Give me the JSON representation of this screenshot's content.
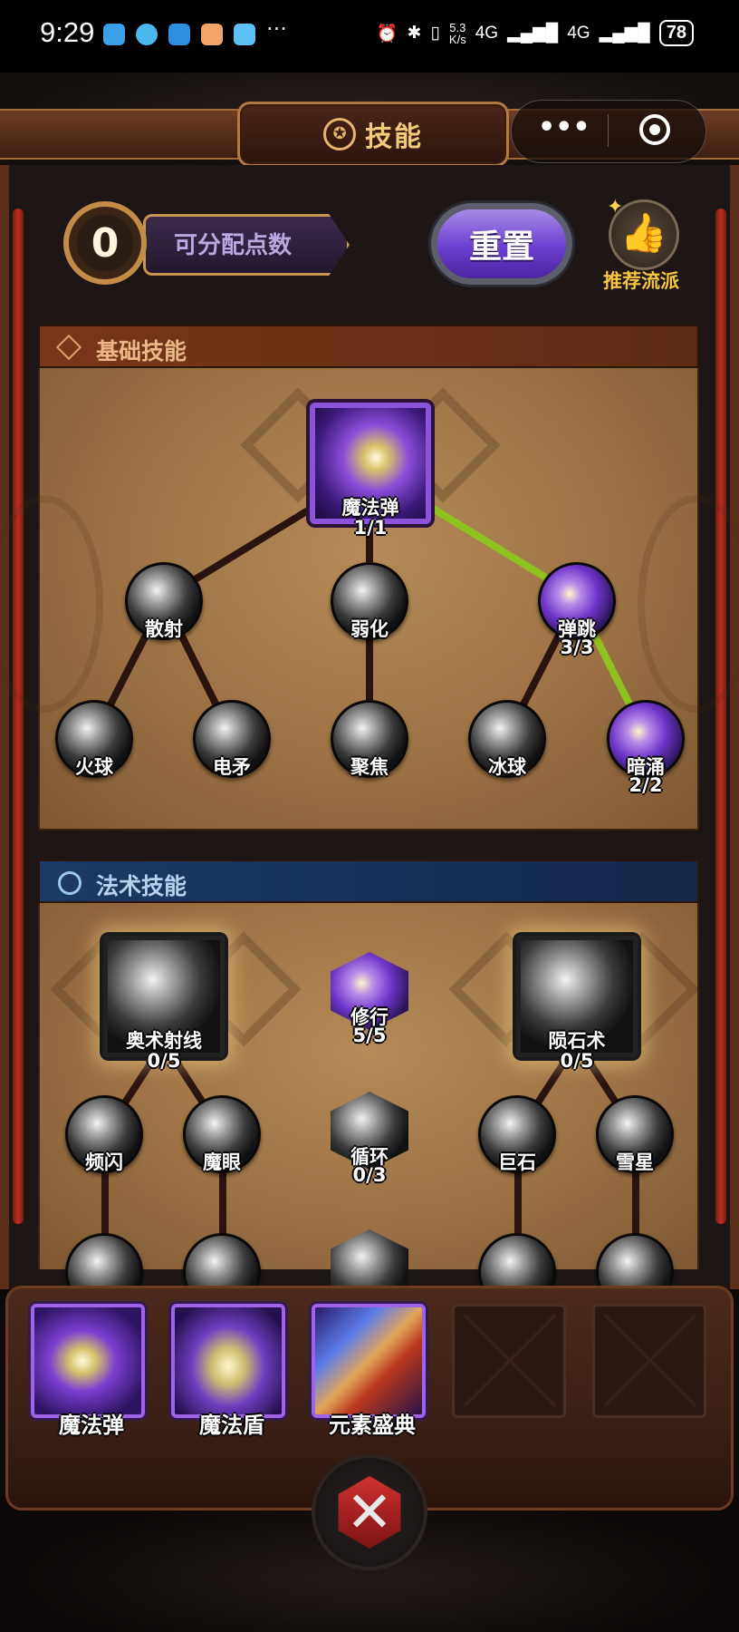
{
  "status_bar": {
    "time": "9:29",
    "more": "···",
    "network_speed_value": "5.3",
    "network_speed_unit": "K/s",
    "sim1": "4G",
    "sim2": "4G",
    "battery": "78"
  },
  "header": {
    "title": "技能",
    "title_icon": "pentagram-icon"
  },
  "capsule": {
    "more": "•••",
    "close_icon": "target-close-icon"
  },
  "points": {
    "value": "0",
    "label": "可分配点数"
  },
  "reset_button": "重置",
  "recommend": {
    "label": "推荐流派",
    "icon": "thumbs-up-icon"
  },
  "basic_skills": {
    "title": "基础技能",
    "icon": "diamond-icon",
    "nodes": [
      {
        "name": "魔法弹",
        "level": "1/1"
      },
      {
        "name": "散射"
      },
      {
        "name": "弱化"
      },
      {
        "name": "弹跳",
        "level": "3/3"
      },
      {
        "name": "火球"
      },
      {
        "name": "电矛"
      },
      {
        "name": "聚焦"
      },
      {
        "name": "冰球"
      },
      {
        "name": "暗涌",
        "level": "2/2"
      }
    ]
  },
  "spell_skills": {
    "title": "法术技能",
    "icon": "swirl-icon",
    "nodes": [
      {
        "name": "奥术射线",
        "level": "0/5"
      },
      {
        "name": "修行",
        "level": "5/5"
      },
      {
        "name": "陨石术",
        "level": "0/5"
      },
      {
        "name": "频闪"
      },
      {
        "name": "魔眼"
      },
      {
        "name": "循环",
        "level": "0/3"
      },
      {
        "name": "巨石"
      },
      {
        "name": "雪星"
      }
    ]
  },
  "equipped": [
    {
      "name": "魔法弹"
    },
    {
      "name": "魔法盾"
    },
    {
      "name": "元素盛典"
    },
    {
      "name": ""
    },
    {
      "name": ""
    }
  ],
  "close_button": "✕",
  "colors": {
    "purple_accent": "#8a55d8",
    "active_line": "#8fc21f",
    "inactive_line": "#2a1410",
    "gold_text": "#f2c978",
    "parchment": "#a67b4b"
  }
}
